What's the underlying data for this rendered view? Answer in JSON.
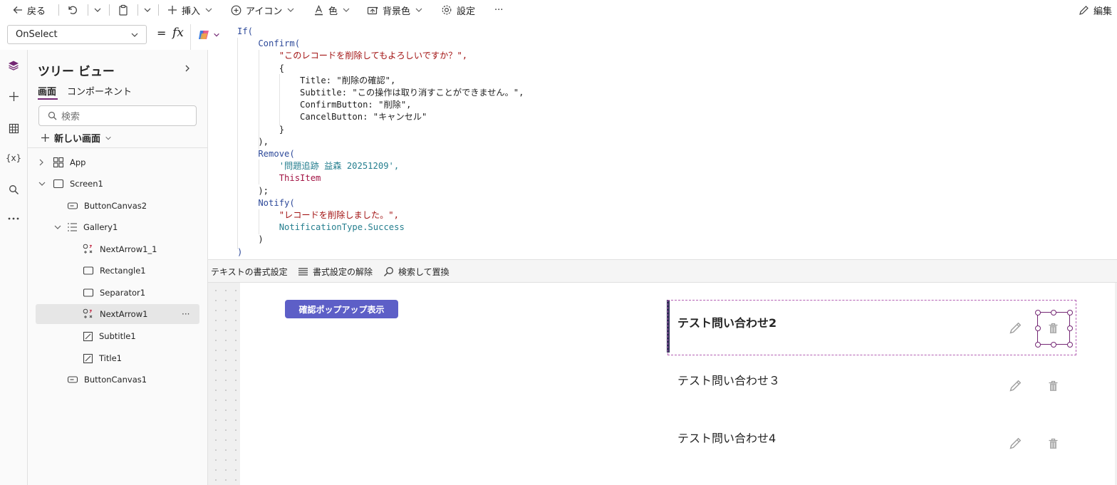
{
  "toolbar": {
    "back": "戻る",
    "insert": "挿入",
    "icon": "アイコン",
    "color": "色",
    "background_color": "背景色",
    "settings": "設定",
    "more": "···",
    "edit": "編集"
  },
  "formula_bar": {
    "property": "OnSelect",
    "equals": "=",
    "fx": "fx"
  },
  "code_lines": [
    "If(",
    "    Confirm(",
    "        \"このレコードを削除してもよろしいですか？\",",
    "        {",
    "            Title: \"削除の確認\",",
    "            Subtitle: \"この操作は取り消すことができません。\",",
    "            ConfirmButton: \"削除\",",
    "            CancelButton: \"キャンセル\"",
    "        }",
    "    ),",
    "    Remove(",
    "        '問題追跡 益森 20251209',",
    "        ThisItem",
    "    );",
    "    Notify(",
    "        \"レコードを削除しました。\",",
    "        NotificationType.Success",
    "    )",
    ")"
  ],
  "code_toolbar": {
    "format_text": "テキストの書式設定",
    "remove_formatting": "書式設定の解除",
    "find_replace": "検索して置換"
  },
  "tree": {
    "title": "ツリー ビュー",
    "tab_screens": "画面",
    "tab_components": "コンポーネント",
    "search_placeholder": "検索",
    "new_screen": "新しい画面",
    "nodes": [
      "App",
      "Screen1",
      "ButtonCanvas2",
      "Gallery1",
      "NextArrow1_1",
      "Rectangle1",
      "Separator1",
      "NextArrow1",
      "Subtitle1",
      "Title1",
      "ButtonCanvas1"
    ],
    "node_more": "···"
  },
  "canvas": {
    "popup_button": "確認ポップアップ表示",
    "rows": [
      "テスト問い合わせ2",
      "テスト問い合わせ３",
      "テスト問い合わせ4"
    ]
  },
  "colors": {
    "accent": "#742774",
    "button": "#5d5fc7",
    "selection": "#b35fb3"
  }
}
